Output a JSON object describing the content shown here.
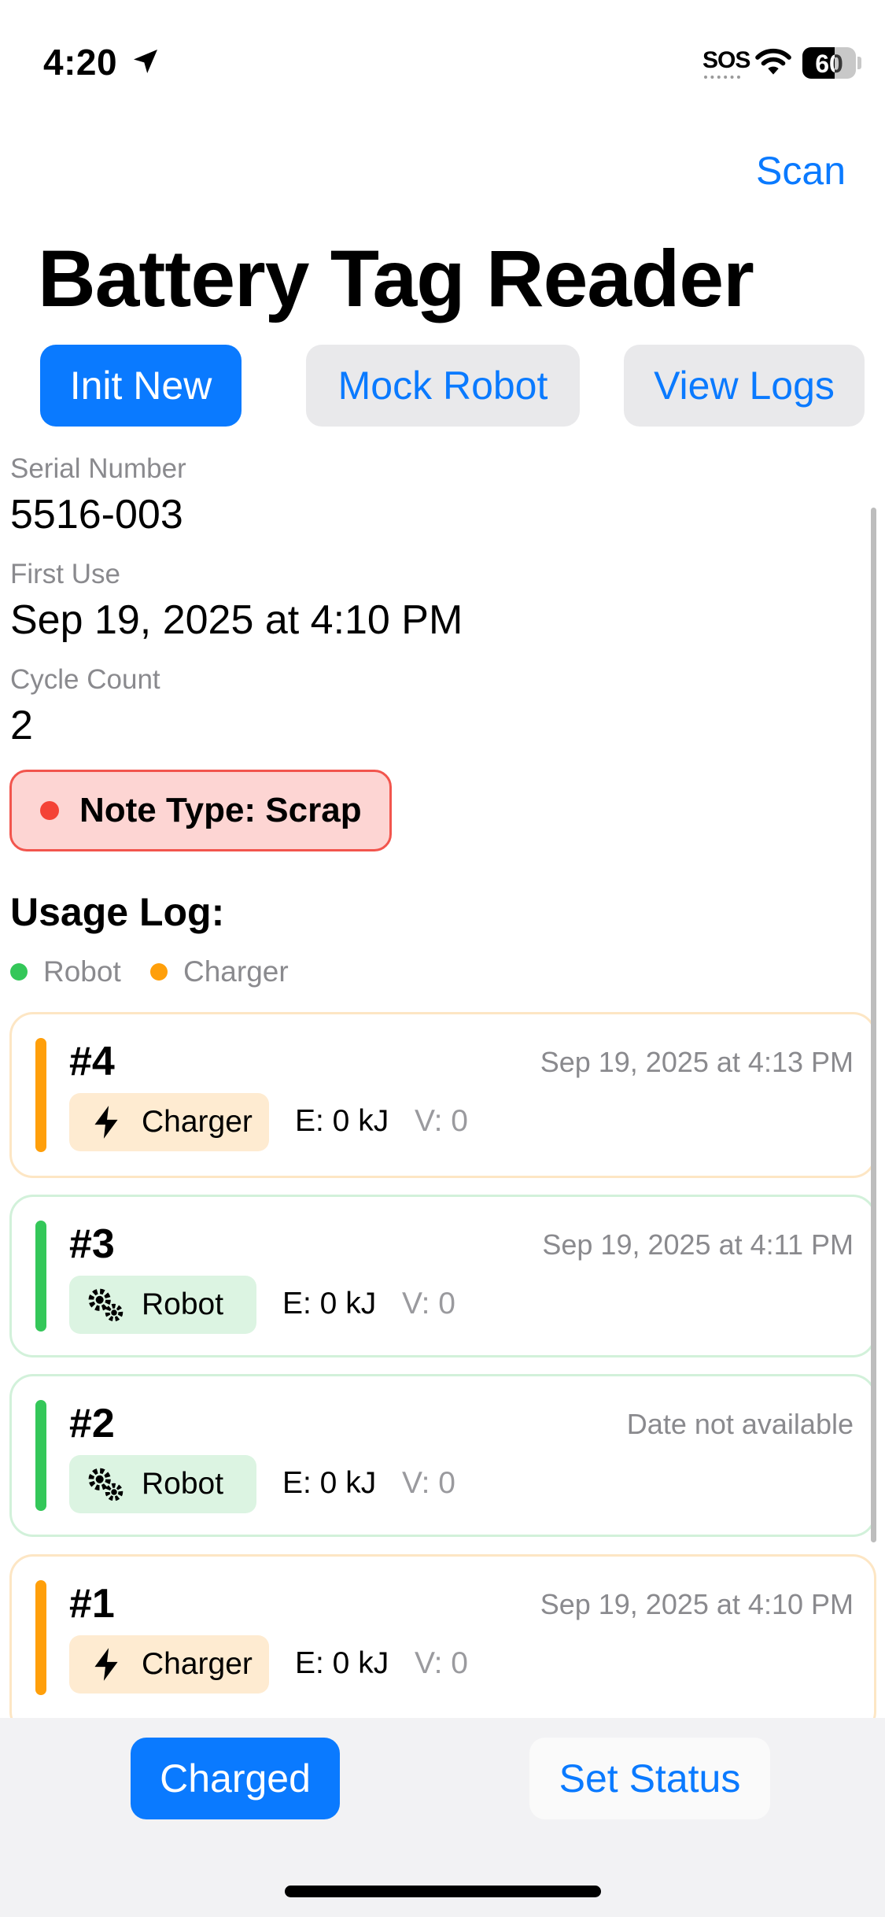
{
  "status_bar": {
    "time": "4:20",
    "sos": "SOS",
    "battery": "60"
  },
  "nav": {
    "scan_label": "Scan"
  },
  "title": "Battery Tag Reader",
  "actions": {
    "init_new": "Init New",
    "mock_robot": "Mock Robot",
    "view_logs": "View Logs"
  },
  "fields": {
    "serial_label": "Serial Number",
    "serial_value": "5516-003",
    "first_use_label": "First Use",
    "first_use_value": "Sep 19, 2025 at 4:10 PM",
    "cycle_label": "Cycle Count",
    "cycle_value": "2"
  },
  "note_status": {
    "text": "Note Type: Scrap",
    "color": "#f44336"
  },
  "usage_log": {
    "title": "Usage Log:",
    "legend": {
      "robot": "Robot",
      "charger": "Charger",
      "robot_color": "#34c759",
      "charger_color": "#ff9f0a"
    },
    "entries": [
      {
        "number": "#4",
        "date": "Sep 19, 2025 at 4:13 PM",
        "type": "Charger",
        "icon": "bolt-icon",
        "energy": "E: 0 kJ",
        "voltage": "V: 0"
      },
      {
        "number": "#3",
        "date": "Sep 19, 2025 at 4:11 PM",
        "type": "Robot",
        "icon": "gears-icon",
        "energy": "E: 0 kJ",
        "voltage": "V: 0"
      },
      {
        "number": "#2",
        "date": "Date not available",
        "type": "Robot",
        "icon": "gears-icon",
        "energy": "E: 0 kJ",
        "voltage": "V: 0"
      },
      {
        "number": "#1",
        "date": "Sep 19, 2025 at 4:10 PM",
        "type": "Charger",
        "icon": "bolt-icon",
        "energy": "E: 0 kJ",
        "voltage": "V: 0"
      }
    ]
  },
  "toolbar": {
    "charged_label": "Charged",
    "set_status_label": "Set Status"
  },
  "colors": {
    "accent": "#0a7aff",
    "scrap_bg": "#fdd5d3",
    "scrap_border": "#f2554d"
  }
}
